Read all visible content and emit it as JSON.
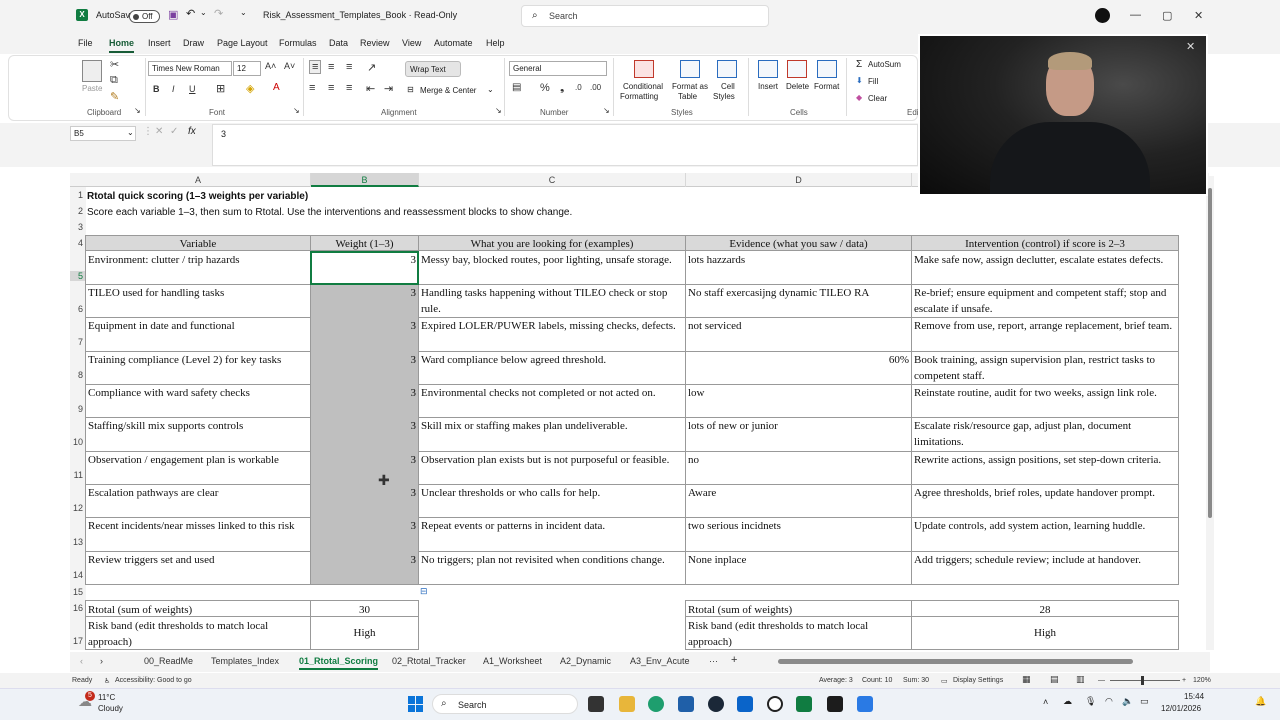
{
  "titlebar": {
    "autosave_label": "AutoSave",
    "autosave_state": "Off",
    "doc_title": "Risk_Assessment_Templates_Book  ·  Read-Only",
    "search_placeholder": "Search",
    "minimize": "—",
    "maximize": "▢",
    "close": "✕"
  },
  "menu": [
    "File",
    "Home",
    "Insert",
    "Draw",
    "Page Layout",
    "Formulas",
    "Data",
    "Review",
    "View",
    "Automate",
    "Help"
  ],
  "ribbon": {
    "paste": "Paste",
    "font_name": "Times New Roman",
    "font_size": "12",
    "wrap_text": "Wrap Text",
    "merge_center": "Merge & Center",
    "number_format": "General",
    "conditional": "Conditional",
    "formatting": "Formatting",
    "format_as": "Format as",
    "table": "Table",
    "cell": "Cell",
    "styles_btn": "Styles",
    "insert": "Insert",
    "delete": "Delete",
    "format": "Format",
    "autosum": "AutoSum",
    "fill": "Fill",
    "clear": "Clear",
    "groups": {
      "clipboard": "Clipboard",
      "font": "Font",
      "alignment": "Alignment",
      "number": "Number",
      "styles": "Styles",
      "cells": "Cells",
      "editing": "Edi"
    }
  },
  "formula_bar": {
    "name_box": "B5",
    "fx": "fx",
    "value": "3"
  },
  "columns": [
    "A",
    "B",
    "C",
    "D"
  ],
  "rows": [
    "1",
    "2",
    "3",
    "4",
    "5",
    "6",
    "7",
    "8",
    "9",
    "10",
    "11",
    "12",
    "13",
    "14",
    "15",
    "16",
    "17"
  ],
  "sheet": {
    "title": "Rtotal quick scoring (1–3 weights per variable)",
    "subtitle": "Score each variable 1–3, then sum to Rtotal. Use the interventions and reassessment blocks to show change.",
    "headers": [
      "Variable",
      "Weight (1–3)",
      "What you are looking for (examples)",
      "Evidence (what you saw / data)",
      "Intervention (control) if score is 2–3"
    ],
    "data_rows": [
      {
        "variable": "Environment: clutter / trip hazards",
        "weight": "3",
        "looking_for": "Messy bay, blocked routes, poor lighting, unsafe storage.",
        "evidence": "lots hazzards",
        "intervention": "Make safe now, assign declutter, escalate estates defects."
      },
      {
        "variable": "TILEO used for handling tasks",
        "weight": "3",
        "looking_for": "Handling tasks happening without TILEO check or stop rule.",
        "evidence": "No staff exercasijng dynamic TILEO RA",
        "intervention": "Re-brief; ensure equipment and competent staff; stop and escalate if unsafe."
      },
      {
        "variable": "Equipment in date and functional",
        "weight": "3",
        "looking_for": "Expired LOLER/PUWER labels, missing checks, defects.",
        "evidence": "not serviced",
        "intervention": "Remove from use, report, arrange replacement, brief team."
      },
      {
        "variable": "Training compliance (Level 2) for key tasks",
        "weight": "3",
        "looking_for": "Ward compliance below agreed threshold.",
        "evidence": "60%",
        "intervention": "Book training, assign supervision plan, restrict tasks to competent staff."
      },
      {
        "variable": "Compliance with ward safety checks",
        "weight": "3",
        "looking_for": "Environmental checks not completed or not acted on.",
        "evidence": "low",
        "intervention": "Reinstate routine, audit for two weeks, assign link role."
      },
      {
        "variable": "Staffing/skill mix supports controls",
        "weight": "3",
        "looking_for": "Skill mix or staffing makes plan undeliverable.",
        "evidence": "lots of new or junior",
        "intervention": "Escalate risk/resource gap, adjust plan, document limitations."
      },
      {
        "variable": "Observation / engagement plan is workable",
        "weight": "3",
        "looking_for": "Observation plan exists but is not purposeful or feasible.",
        "evidence": "no",
        "intervention": "Rewrite actions, assign positions, set step-down criteria."
      },
      {
        "variable": "Escalation pathways are clear",
        "weight": "3",
        "looking_for": "Unclear thresholds or who calls for help.",
        "evidence": "Aware",
        "intervention": "Agree thresholds, brief roles, update handover prompt."
      },
      {
        "variable": "Recent incidents/near misses linked to this risk",
        "weight": "3",
        "looking_for": "Repeat events or patterns in incident data.",
        "evidence": "two serious incidnets",
        "intervention": "Update controls, add system action, learning huddle."
      },
      {
        "variable": "Review triggers set and used",
        "weight": "3",
        "looking_for": "No triggers; plan not revisited when conditions change.",
        "evidence": "None inplace",
        "intervention": "Add triggers; schedule review; include at handover."
      }
    ],
    "rtotal_label": "Rtotal (sum of weights)",
    "rtotal_value": "30",
    "riskband_label": "Risk band (edit thresholds to match local approach)",
    "riskband_value": "High",
    "reassess_rtotal_label": "Rtotal (sum of weights)",
    "reassess_rtotal_value": "28",
    "reassess_riskband_label": "Risk band (edit thresholds to match local approach)",
    "reassess_riskband_value": "High"
  },
  "tabs": [
    "00_ReadMe",
    "Templates_Index",
    "01_Rtotal_Scoring",
    "02_Rtotal_Tracker",
    "A1_Worksheet",
    "A2_Dynamic",
    "A3_Env_Acute"
  ],
  "tabs_more": "···",
  "tabs_add": "+",
  "status": {
    "ready": "Ready",
    "accessibility": "Accessibility: Good to go",
    "average": "Average: 3",
    "count": "Count: 10",
    "sum": "Sum: 30",
    "display_settings": "Display Settings",
    "zoom": "120%"
  },
  "taskbar": {
    "weather_temp": "11°C",
    "weather_desc": "Cloudy",
    "notification_count": "5",
    "search": "Search",
    "time": "15:44",
    "date": "12/01/2026"
  },
  "colors": {
    "excel_green": "#107c41",
    "header_fill": "#d9d9d9",
    "weight_fill": "#bfbfbf"
  }
}
